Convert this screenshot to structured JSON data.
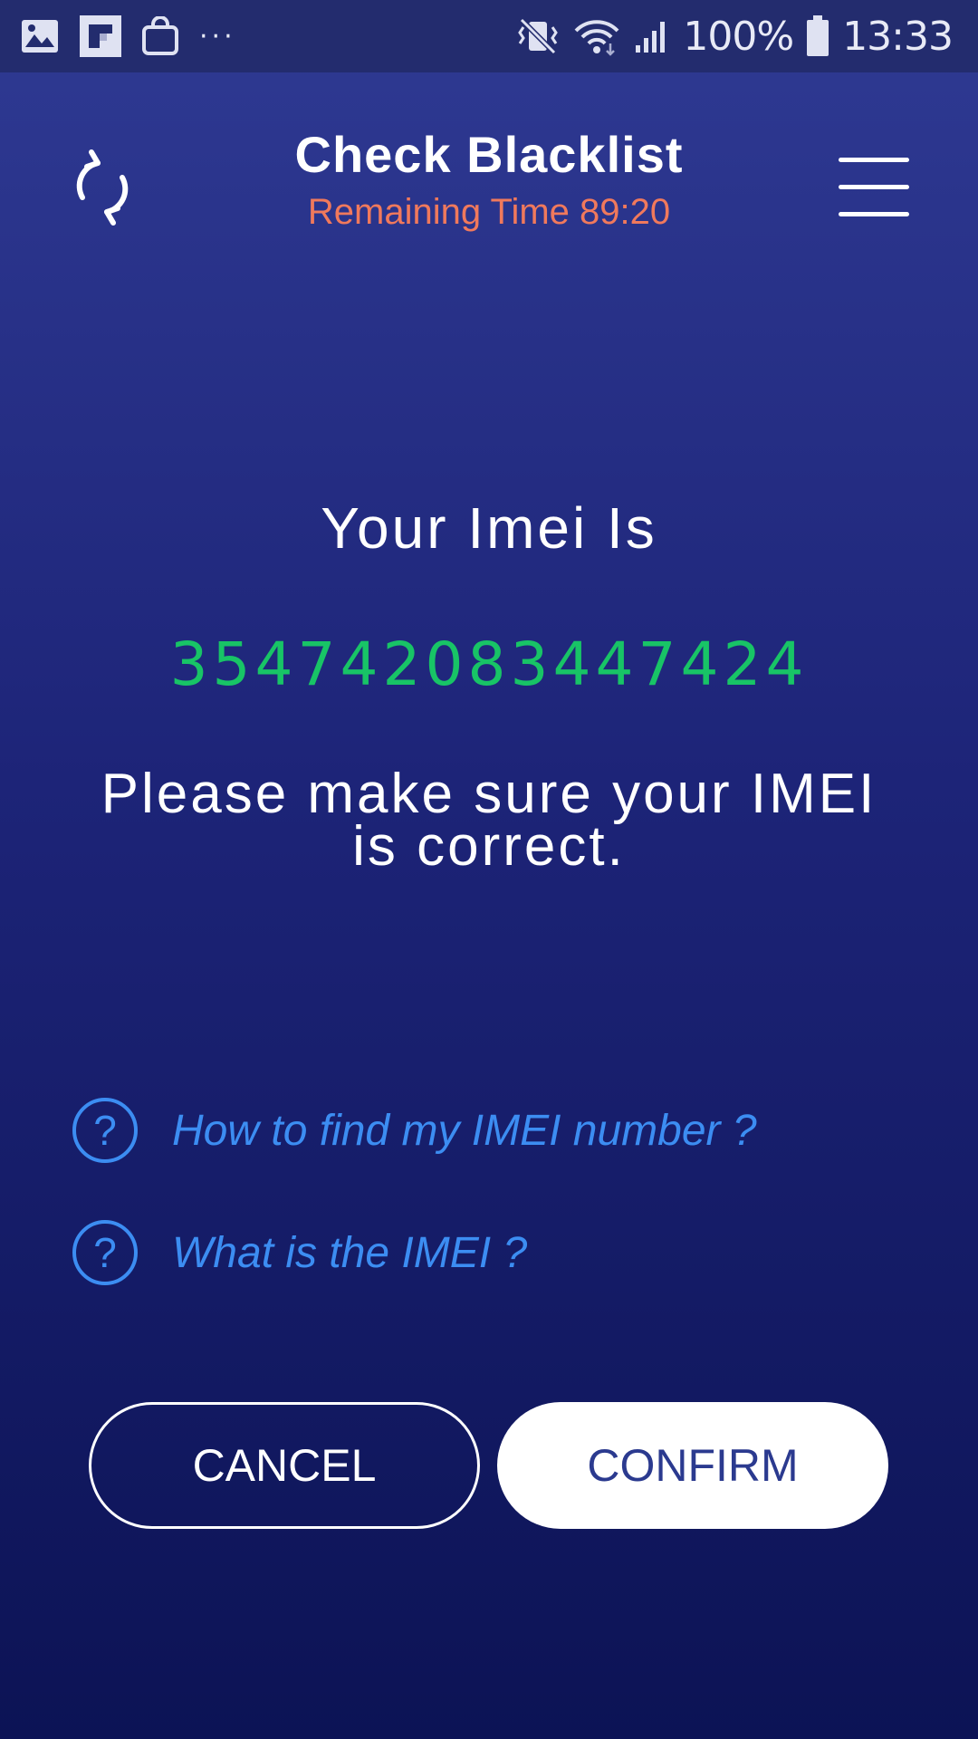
{
  "status_bar": {
    "left_icons": [
      "gallery-icon",
      "flipboard-icon",
      "shopping-bag-icon",
      "more-dots-icon"
    ],
    "more_label": "···",
    "right_icons": [
      "vibrate-mute-icon",
      "wifi-icon",
      "signal-icon",
      "battery-icon"
    ],
    "battery_percent": "100%",
    "time": "13:33"
  },
  "header": {
    "title": "Check Blacklist",
    "subtitle": "Remaining Time 89:20",
    "left_icon": "refresh-icon",
    "right_icon": "hamburger-menu-icon"
  },
  "main": {
    "imei_label": "Your Imei Is",
    "imei_value": "354742083447424",
    "notice_line1": "Please make sure your IMEI",
    "notice_line2": "is correct."
  },
  "help_links": [
    {
      "icon": "question-circle-icon",
      "label": "How to find my IMEI number ?"
    },
    {
      "icon": "question-circle-icon",
      "label": "What is the IMEI ?"
    }
  ],
  "buttons": {
    "cancel_label": "CANCEL",
    "confirm_label": "CONFIRM"
  },
  "colors": {
    "background_top": "#2f3a93",
    "background_bottom": "#0c1355",
    "subtitle": "#f0795c",
    "imei_value": "#18c466",
    "help_link": "#3c8df2",
    "confirm_text": "#2b3a8f"
  }
}
